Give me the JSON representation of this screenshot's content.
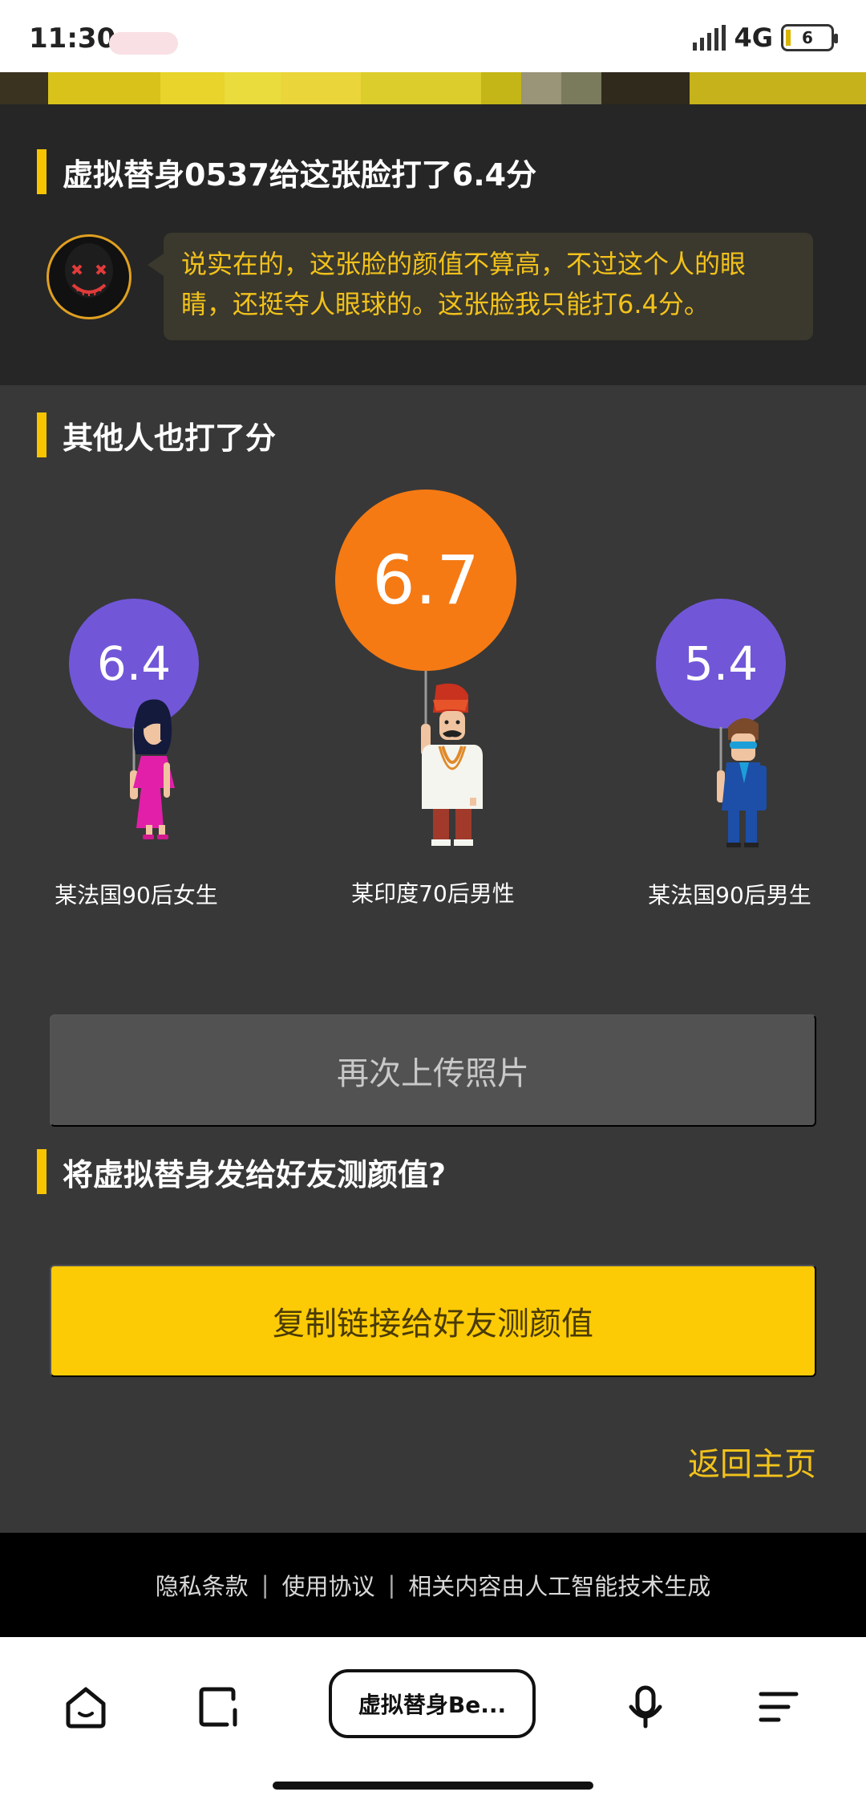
{
  "status_bar": {
    "time": "11:30",
    "network": "4G",
    "battery": "6"
  },
  "rating": {
    "heading": "虚拟替身0537给这张脸打了6.4分",
    "comment": "说实在的，这张脸的颜值不算高，不过这个人的眼睛，还挺夺人眼球的。这张脸我只能打6.4分。"
  },
  "others": {
    "heading": "其他人也打了分",
    "judges": [
      {
        "score": "6.4",
        "caption": "某法国90后女生",
        "color": "#7157d8"
      },
      {
        "score": "6.7",
        "caption": "某印度70后男性",
        "color": "#f57a14"
      },
      {
        "score": "5.4",
        "caption": "某法国90后男生",
        "color": "#7157d8"
      }
    ]
  },
  "actions": {
    "reupload_label": "再次上传照片",
    "share_heading": "将虚拟替身发给好友测颜值?",
    "copy_label": "复制链接给好友测颜值",
    "home_link": "返回主页"
  },
  "footer": {
    "privacy": "隐私条款",
    "terms": "使用协议",
    "ai_notice": "相关内容由人工智能技术生成",
    "separator": "|"
  },
  "browser": {
    "address": "虚拟替身Be..."
  },
  "colors": {
    "accent": "#f6c400",
    "button_yellow": "#fccb05",
    "comment_text": "#f2c21b"
  }
}
